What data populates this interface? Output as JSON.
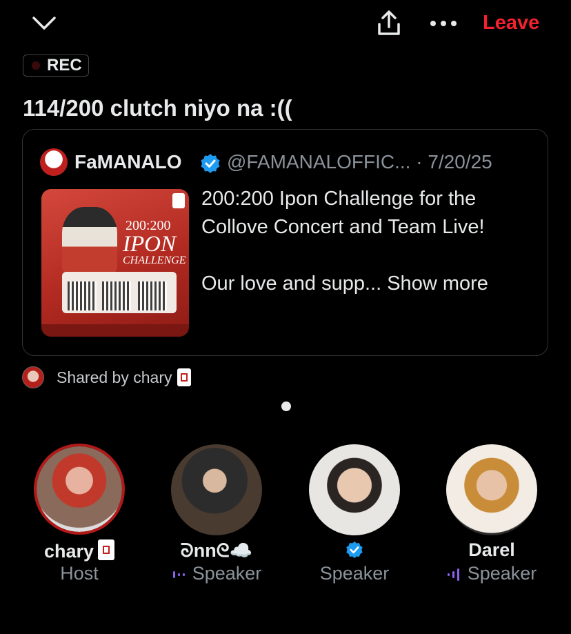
{
  "topbar": {
    "leave_label": "Leave"
  },
  "rec_label": "REC",
  "space_title": "114/200 clutch niyo na :((",
  "post": {
    "author_name": "FaMANALO",
    "handle_date": "@FAMANALOFFIC... · 7/20/25",
    "image_text": {
      "line1": "200:200",
      "line2": "IPON",
      "line3": "CHALLENGE"
    },
    "body_line1": "200:200 Ipon Challenge for the",
    "body_line2": "Collove Concert and Team Live!",
    "body_line3": "Our love and supp...",
    "show_more": "Show more"
  },
  "shared_text": "Shared by chary",
  "participants": [
    {
      "name": "chary",
      "role": "Host"
    },
    {
      "name": "ᘐnnᘓ☁️",
      "role": "Speaker"
    },
    {
      "name": "",
      "role": "Speaker"
    },
    {
      "name": "Darel",
      "role": "Speaker"
    }
  ],
  "colors": {
    "background": "#000000",
    "leave": "#f4212e",
    "verified": "#1d9bf0",
    "speaking": "#8b63f0",
    "host_ring": "#b21a1a"
  }
}
